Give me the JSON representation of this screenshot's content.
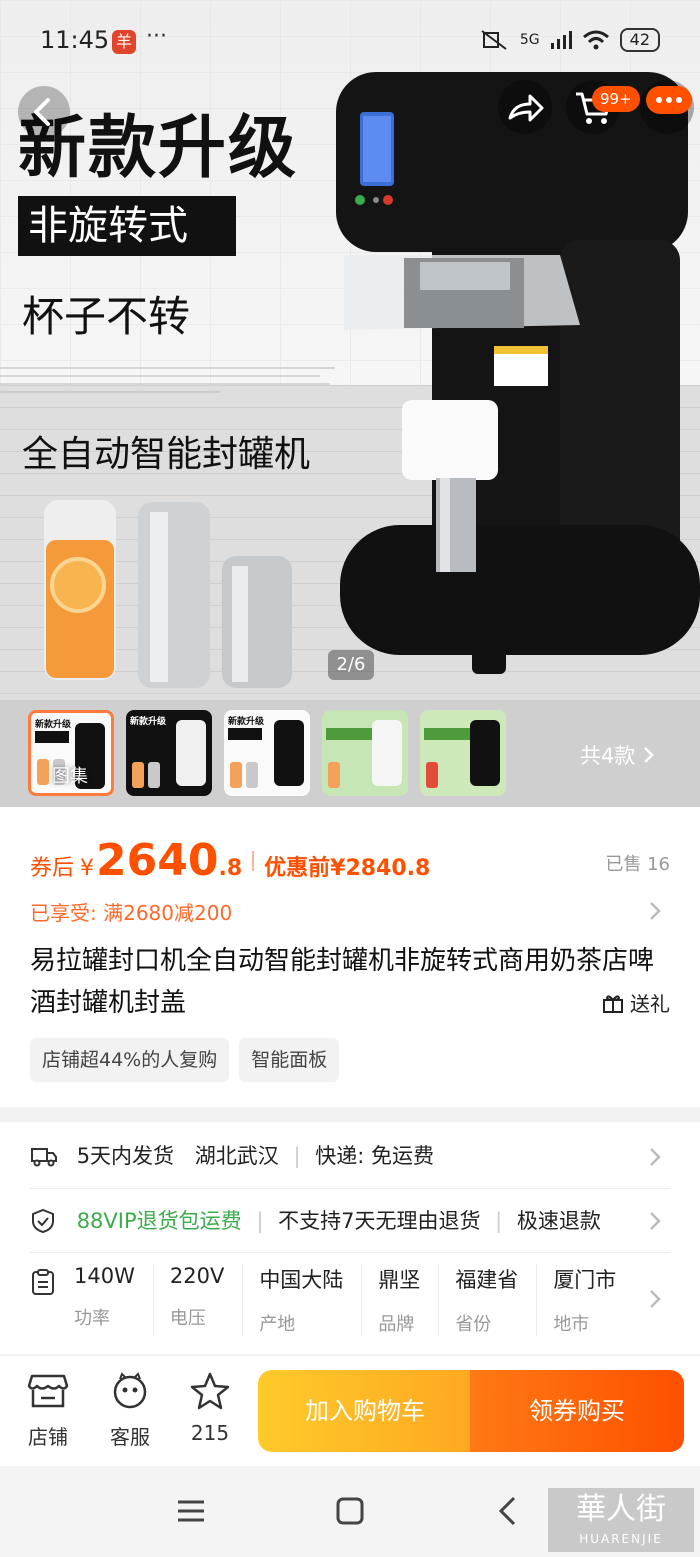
{
  "status_bar": {
    "time": "11:45",
    "app_icon_glyph": "羊",
    "more": "···",
    "network": "5G",
    "battery": "42"
  },
  "top_actions": {
    "cart_badge": "99+"
  },
  "hero": {
    "promo_line1": "新款升级",
    "promo_line2": "非旋转式",
    "promo_line3": "杯子不转",
    "promo_line4": "全自动智能封罐机",
    "image_counter": "2/6"
  },
  "gallery": {
    "caption": "图集",
    "styles_count": "共4款"
  },
  "price": {
    "label": "券后",
    "currency": "¥",
    "integer": "2640",
    "decimal": ".8",
    "original": "优惠前¥2840.8",
    "sold": "已售 16",
    "promotion": "已享受: 满2680减200"
  },
  "product": {
    "title": "易拉罐封口机全自动智能封罐机非旋转式商用奶茶店啤酒封罐机封盖",
    "gift": "送礼",
    "tags": [
      "店铺超44%的人复购",
      "智能面板"
    ]
  },
  "service": {
    "delivery_time": "5天内发货",
    "origin": "湖北武汉",
    "shipping": "快递: 免运费",
    "vip_return": "88VIP退货包运费",
    "no_return": "不支持7天无理由退货",
    "fast_refund": "极速退款"
  },
  "specs": [
    {
      "value": "140W",
      "key": "功率"
    },
    {
      "value": "220V",
      "key": "电压"
    },
    {
      "value": "中国大陆",
      "key": "产地"
    },
    {
      "value": "鼎坚",
      "key": "品牌"
    },
    {
      "value": "福建省",
      "key": "省份"
    },
    {
      "value": "厦门市",
      "key": "地市"
    }
  ],
  "bottom_bar": {
    "store": "店铺",
    "service": "客服",
    "favorites": "215",
    "add_to_cart": "加入购物车",
    "buy_with_coupon": "领券购买"
  },
  "watermark": {
    "main": "華人街",
    "sub": "HUARENJIE"
  },
  "colors": {
    "accent": "#ff5000",
    "vip_green": "#3cab4c",
    "cart_gradient_start": "#ffca2b"
  }
}
